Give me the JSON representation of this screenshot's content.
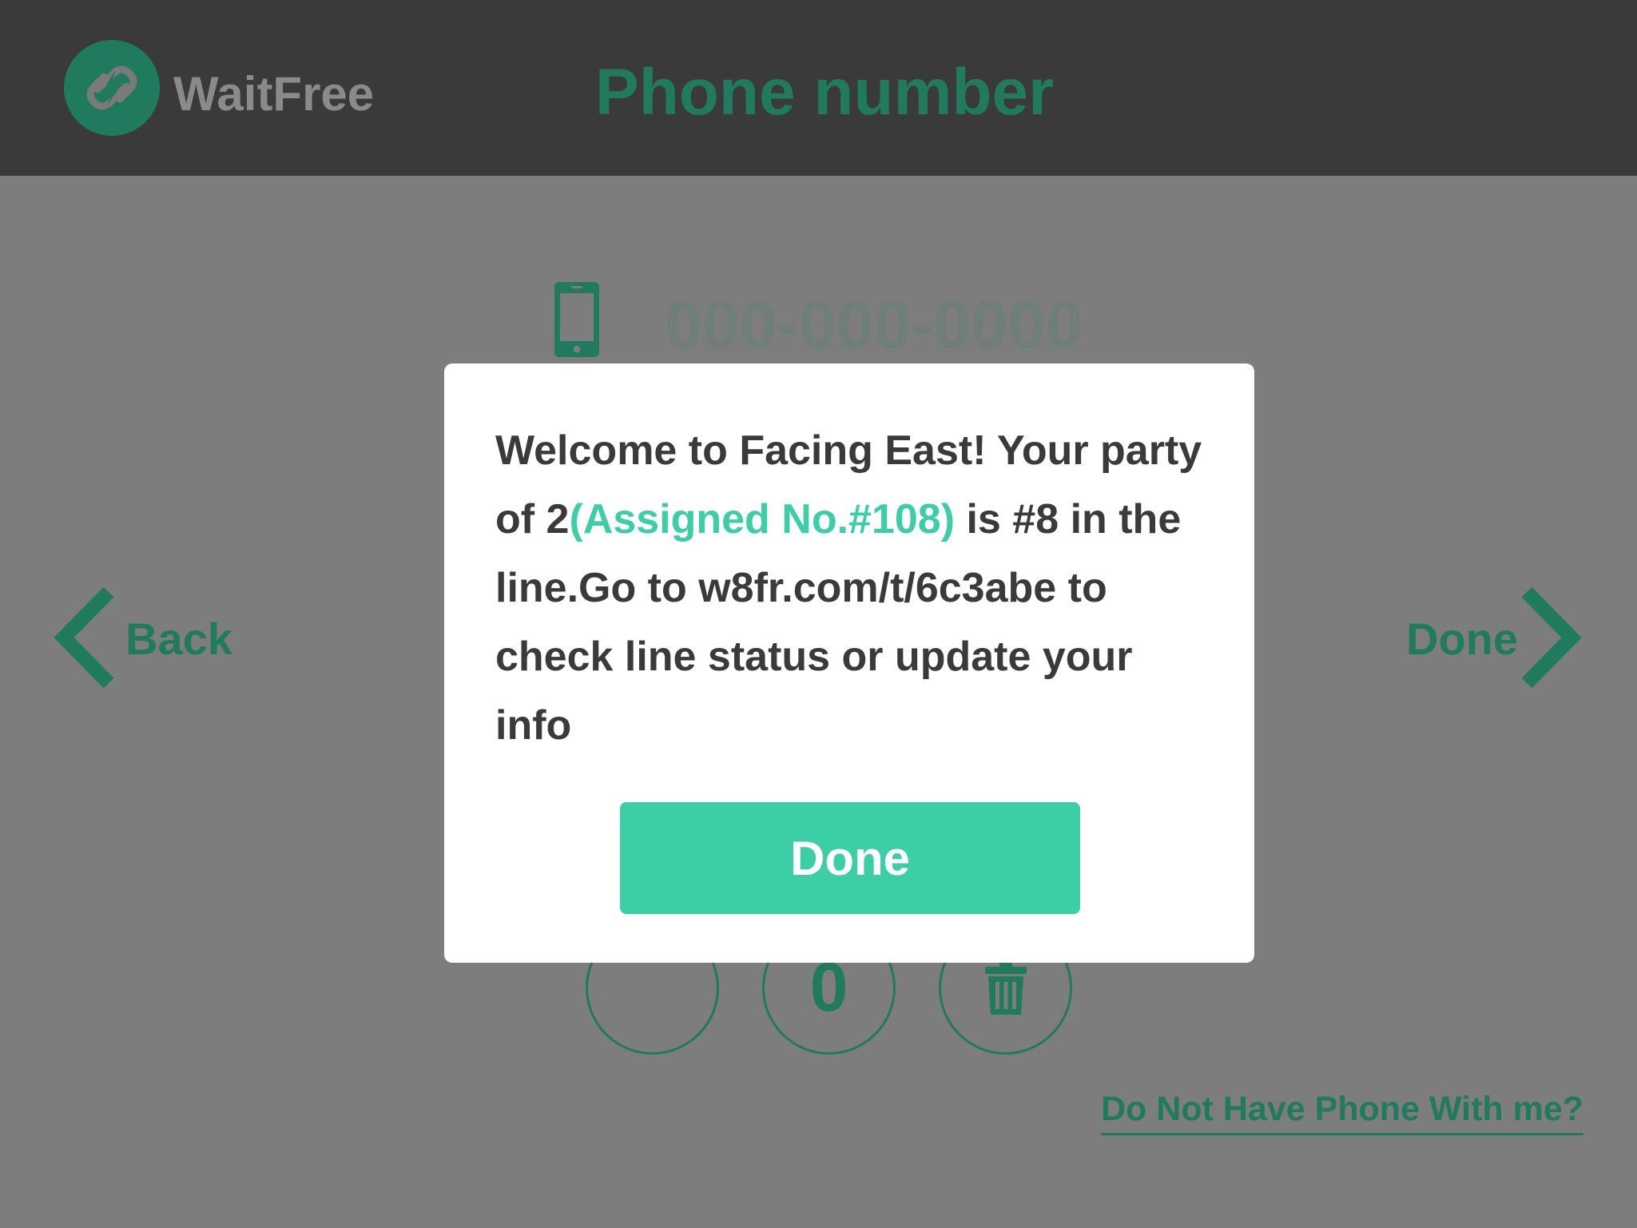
{
  "header": {
    "brand": "WaitFree",
    "page_title": "Phone number"
  },
  "phone": {
    "placeholder_display": "000-000-0000"
  },
  "nav": {
    "back_label": "Back",
    "done_label": "Done"
  },
  "keypad": {
    "zero_label": "0"
  },
  "links": {
    "no_phone": "Do Not Have Phone With me?"
  },
  "modal": {
    "text_before": "Welcome to Facing East! Your party of 2",
    "assigned": "(Assigned No.#108)",
    "text_after": " is #8 in the line.Go to w8fr.com/t/6c3abe to check line status or update your info",
    "button_label": "Done"
  },
  "colors": {
    "background": "#7d7d7d",
    "header_bg": "#3a3a3a",
    "brand_green": "#1f7a5e",
    "accent": "#3ccfa7",
    "modal_bg": "#ffffff",
    "modal_text": "#3a3a3a"
  },
  "icons": {
    "logo": "lightning-link-icon",
    "phone": "mobile-phone-icon",
    "back": "chevron-left-icon",
    "forward": "chevron-right-icon",
    "delete": "trash-icon"
  }
}
